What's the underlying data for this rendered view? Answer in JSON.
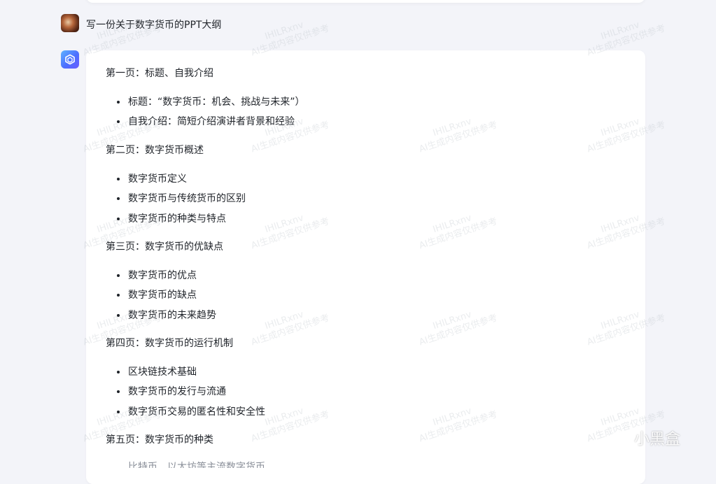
{
  "user_message": "写一份关于数字货币的PPT大纲",
  "answer": {
    "sections": [
      {
        "title": "第一页：标题、自我介绍",
        "items": [
          "标题：“数字货币：机会、挑战与未来”）",
          "自我介绍：简短介绍演讲者背景和经验"
        ]
      },
      {
        "title": "第二页：数字货币概述",
        "items": [
          "数字货币定义",
          "数字货币与传统货币的区别",
          "数字货币的种类与特点"
        ]
      },
      {
        "title": "第三页：数字货币的优缺点",
        "items": [
          "数字货币的优点",
          "数字货币的缺点",
          "数字货币的未来趋势"
        ]
      },
      {
        "title": "第四页：数字货币的运行机制",
        "items": [
          "区块链技术基础",
          "数字货币的发行与流通",
          "数字货币交易的匿名性和安全性"
        ]
      },
      {
        "title": "第五页：数字货币的种类",
        "items": [
          "比特币、以太坊等主流数字货币"
        ]
      }
    ]
  },
  "watermark": {
    "code": "IHlLRxnv",
    "notice": "AI生成内容仅供参考"
  },
  "site_logo": {
    "text": "小黑盒",
    "icon": "heybox-logo-icon"
  },
  "colors": {
    "background": "#f3f4f9",
    "card": "#ffffff",
    "text": "#1f2329",
    "bot_avatar_start": "#5fb3ff",
    "bot_avatar_end": "#6a5cff"
  }
}
